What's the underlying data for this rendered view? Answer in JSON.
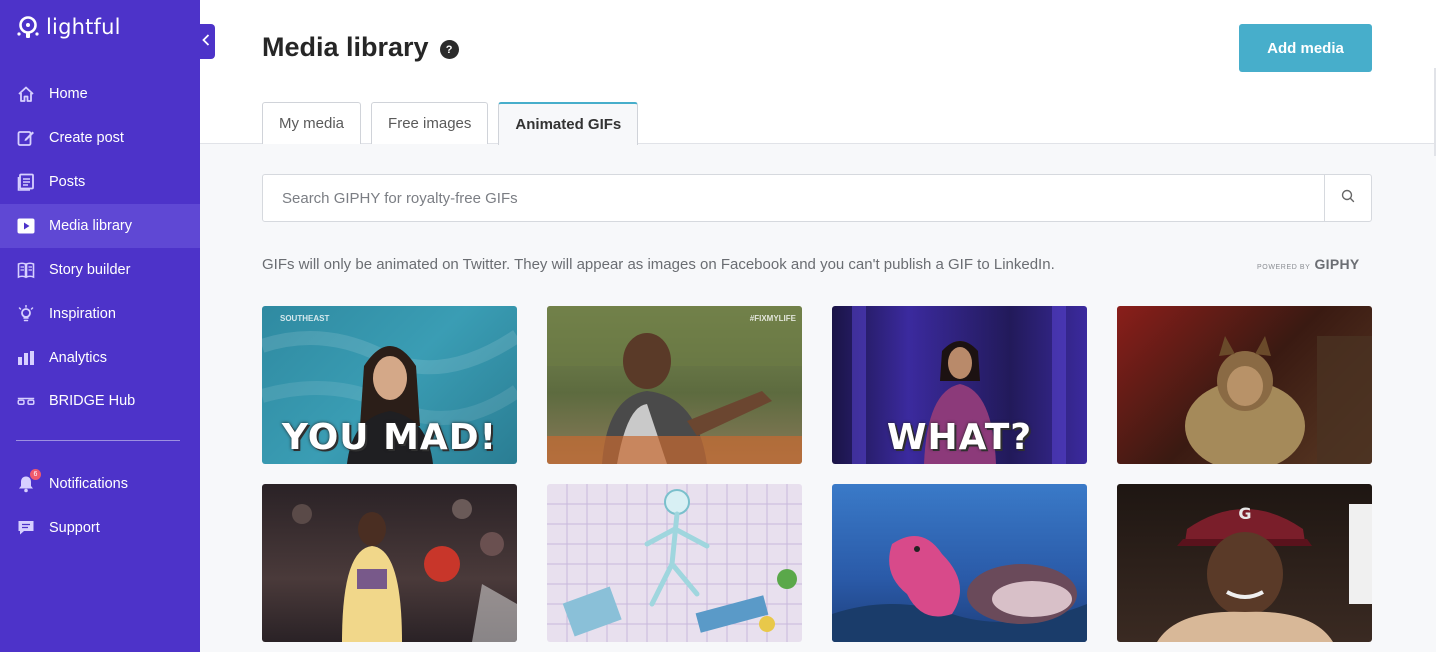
{
  "app": {
    "logo_text": "lightful",
    "colors": {
      "sidebar": "#4d33c9",
      "accent": "#47aecb",
      "active_nav": "#5f48d4",
      "badge": "#ef5a6c"
    }
  },
  "sidebar": {
    "items": [
      {
        "label": "Home",
        "icon": "home-icon"
      },
      {
        "label": "Create post",
        "icon": "edit-icon"
      },
      {
        "label": "Posts",
        "icon": "posts-icon"
      },
      {
        "label": "Media library",
        "icon": "play-icon",
        "active": true
      },
      {
        "label": "Story builder",
        "icon": "book-icon"
      },
      {
        "label": "Inspiration",
        "icon": "lightbulb-icon"
      },
      {
        "label": "Analytics",
        "icon": "bar-chart-icon"
      },
      {
        "label": "BRIDGE Hub",
        "icon": "glasses-icon"
      }
    ],
    "secondary": [
      {
        "label": "Notifications",
        "icon": "bell-icon",
        "badge": "6"
      },
      {
        "label": "Support",
        "icon": "chat-icon"
      }
    ]
  },
  "header": {
    "title": "Media library",
    "help_glyph": "?",
    "add_button": "Add media",
    "tabs": [
      {
        "label": "My media"
      },
      {
        "label": "Free images"
      },
      {
        "label": "Animated GIFs",
        "active": true
      }
    ]
  },
  "search": {
    "placeholder": "Search GIPHY for royalty-free GIFs",
    "value": ""
  },
  "info": {
    "text": "GIFs will only be animated on Twitter. They will appear as images on Facebook and you can't publish a GIF to LinkedIn.",
    "powered_by": "POWERED BY",
    "giphy": "GIPHY"
  },
  "gifs": [
    {
      "caption": "YOU MAD!",
      "tag": "SOUTHEAST"
    },
    {
      "caption": "",
      "tag": "#FIXMYLIFE"
    },
    {
      "caption": "WHAT?",
      "tag": ""
    },
    {
      "caption": "",
      "tag": ""
    },
    {
      "caption": "",
      "tag": ""
    },
    {
      "caption": "",
      "tag": ""
    },
    {
      "caption": "",
      "tag": ""
    },
    {
      "caption": "",
      "tag": ""
    }
  ]
}
